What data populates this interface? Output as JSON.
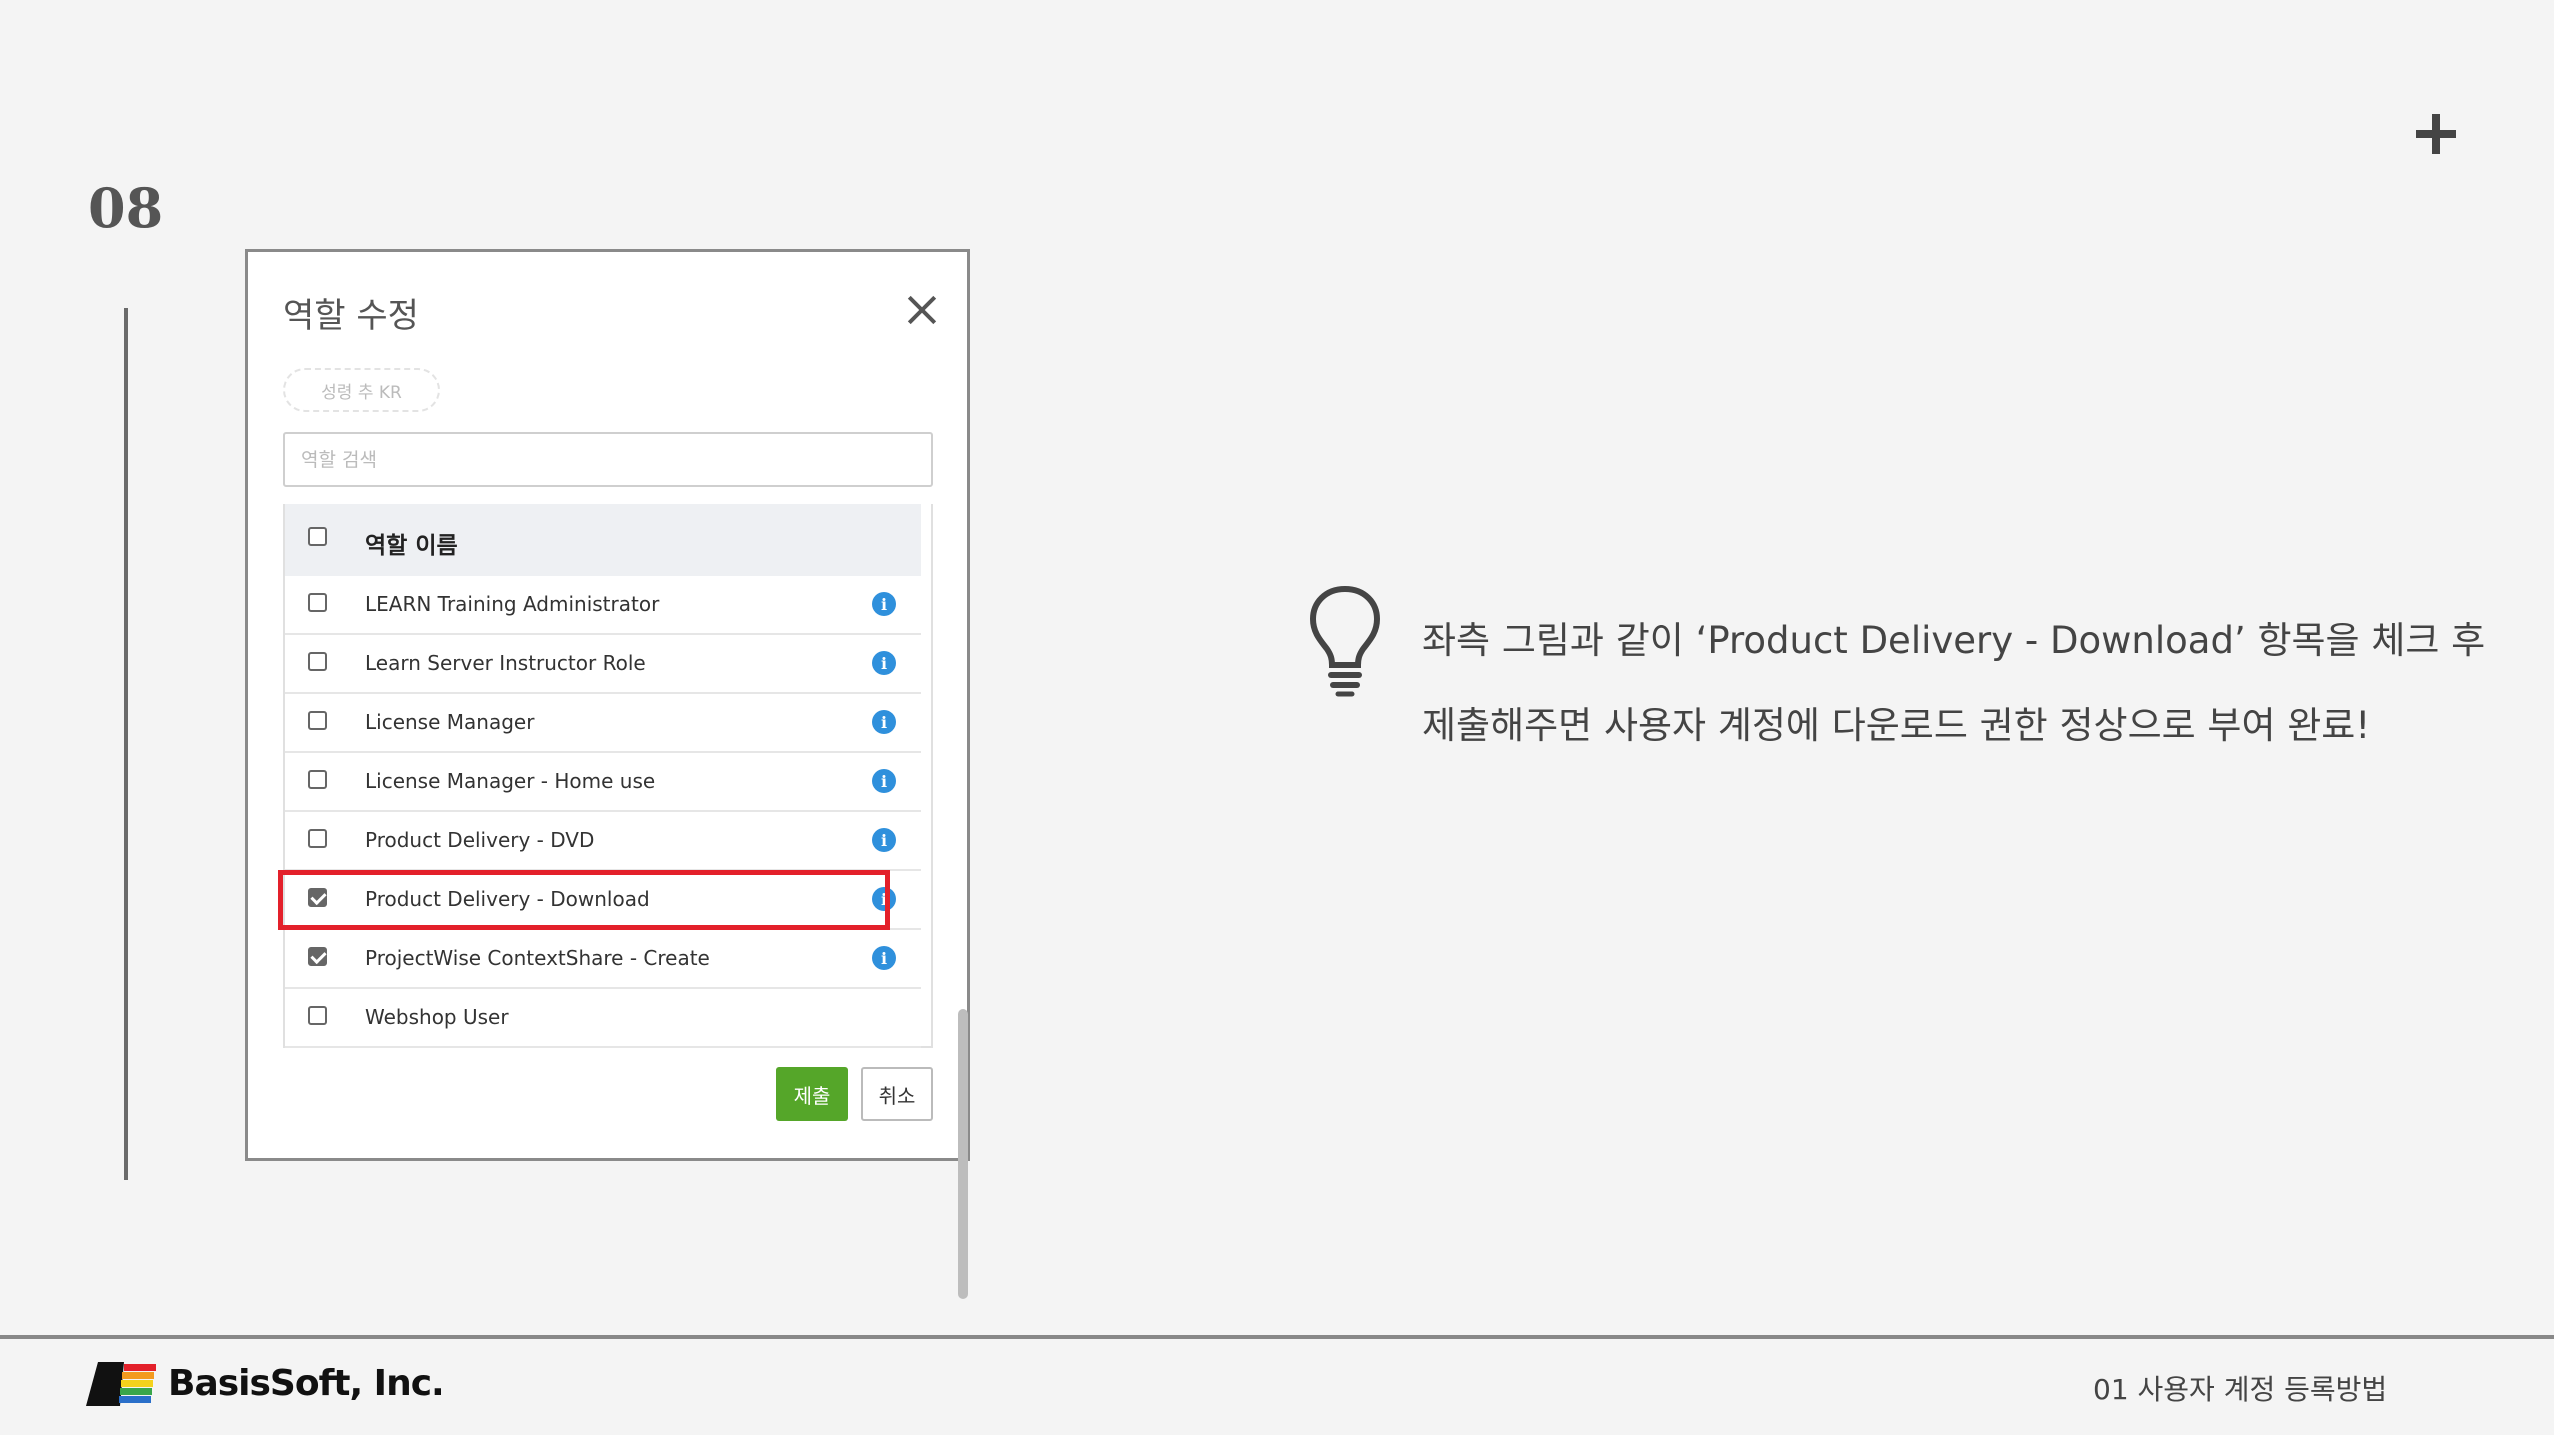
{
  "slide": {
    "number": "08"
  },
  "modal": {
    "title": "역할 수정",
    "tag_chip": "성령 추 KR",
    "search_placeholder": "역할 검색",
    "table_header": "역할 이름",
    "rows": [
      {
        "label": "LEARN Training Administrator",
        "checked": false,
        "info": true
      },
      {
        "label": "Learn Server Instructor Role",
        "checked": false,
        "info": true
      },
      {
        "label": "License Manager",
        "checked": false,
        "info": true
      },
      {
        "label": "License Manager - Home use",
        "checked": false,
        "info": true
      },
      {
        "label": "Product Delivery - DVD",
        "checked": false,
        "info": true
      },
      {
        "label": "Product Delivery - Download",
        "checked": true,
        "info": true,
        "highlighted": true
      },
      {
        "label": "ProjectWise ContextShare - Create",
        "checked": true,
        "info": true
      },
      {
        "label": "Webshop User",
        "checked": false,
        "info": false
      }
    ],
    "info_glyph": "i",
    "submit_label": "제출",
    "cancel_label": "취소"
  },
  "note": {
    "line1": "좌측 그림과 같이 ‘Product Delivery  -  Download’ 항목을 체크 후",
    "line2": "제출해주면 사용자 계정에 다운로드 권한 정상으로 부여 완료!"
  },
  "footer": {
    "company": "BasisSoft, Inc.",
    "section": "01 사용자 계정 등록방법"
  },
  "colors": {
    "accent_submit": "#55a629",
    "highlight": "#e3202a",
    "info": "#2f90dc"
  }
}
